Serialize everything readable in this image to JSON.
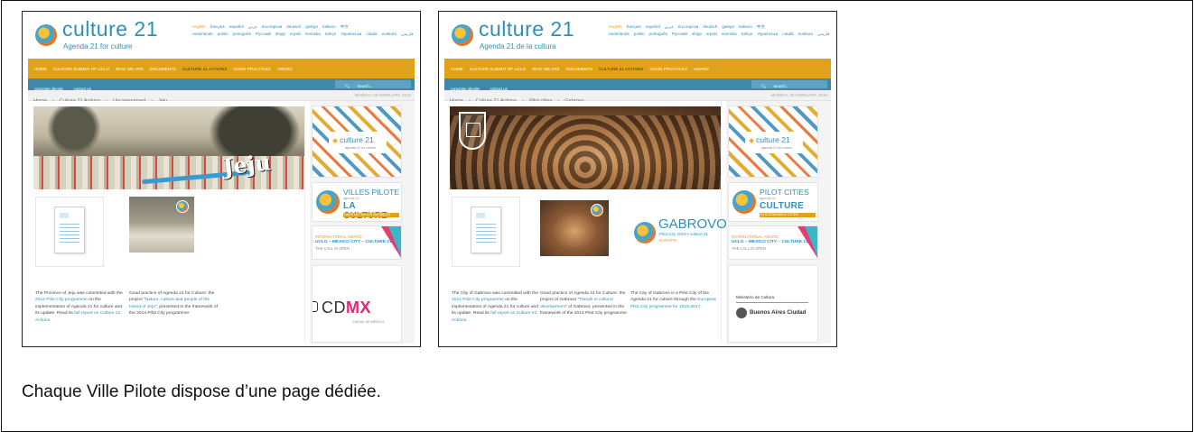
{
  "caption": "Chaque Ville Pilote dispose d’une page dédiée.",
  "languages": [
    {
      "label": "english",
      "active": true
    },
    {
      "label": "français",
      "active": false
    },
    {
      "label": "español",
      "active": false
    },
    {
      "label": "عربي",
      "active": false
    },
    {
      "label": "Български",
      "active": false
    },
    {
      "label": "deutsch",
      "active": false
    },
    {
      "label": "galego",
      "active": false
    },
    {
      "label": "italiano",
      "active": false
    },
    {
      "label": "中文",
      "active": false
    },
    {
      "label": "nederlands",
      "active": false
    },
    {
      "label": "polski",
      "active": false
    },
    {
      "label": "português",
      "active": false
    },
    {
      "label": "Русский",
      "active": false
    },
    {
      "label": "shqip",
      "active": false
    },
    {
      "label": "srpski",
      "active": false
    },
    {
      "label": "svenska",
      "active": false
    },
    {
      "label": "türkçe",
      "active": false
    },
    {
      "label": "Українська",
      "active": false
    },
    {
      "label": "català",
      "active": false
    },
    {
      "label": "euskara",
      "active": false
    },
    {
      "label": "فارسی",
      "active": false
    }
  ],
  "nav": [
    {
      "label": "HOME",
      "active": false
    },
    {
      "label": "CULTURE SUMMIT OF UCLG",
      "active": false
    },
    {
      "label": "WHO WE ARE",
      "active": false
    },
    {
      "label": "DOCUMENTS",
      "active": false
    },
    {
      "label": "CULTURE 21 ACTIONS",
      "active": true
    },
    {
      "label": "GOOD PRACTICES",
      "active": false
    },
    {
      "label": "AWARD",
      "active": false
    }
  ],
  "subnav": [
    "corporate identity",
    "contact us"
  ],
  "search_placeholder": "Search...",
  "date": "MONDAY, 08 FEBRUARY, 2016",
  "site": {
    "logo": "culture 21",
    "tagline_1": "Agenda 21 for culture",
    "tagline_2": "Agenda 21 de la cultura"
  },
  "jeju": {
    "crumbs": [
      "Home",
      "›",
      "Culture 21 Actions",
      "›",
      "Uncategorised",
      "›",
      "Jeju"
    ],
    "hero_word": "Jeju",
    "para1": {
      "pre": "The Province of Jeju was committed with the ",
      "link1": "2014 Pilot City programme",
      "mid": " on the implementation of Agenda 21 for culture and its update. Read its ",
      "link2": "full report on Culture 21: Actions",
      "post": "."
    },
    "para2": {
      "pre": "Good practice of Agenda 21 for Culture: the project \"",
      "link": "Nature, culture and people of the Island of Jeju",
      "post": "\", presented in the framework of the 2014 Pilot City programme."
    },
    "side": {
      "b1_logo": "culture 21",
      "b1_sub": "agenda 21 for culture",
      "b2_t1": "VILLES PILOTE",
      "b2_t2": "agenda 21",
      "b2_t3": "LA CULTURE",
      "b2_t4": "DANS LES VILLES DURABLES",
      "b3_l1": "INTERNATIONAL AWARD",
      "b3_l2": "UCLG – MEXICO CITY – CULTURE 21",
      "b3_l3": "THE CALL IS OPEN",
      "b4_brand": "CD",
      "b4_brand_hi": "MX",
      "b4_sub": "CIUDAD DE MÉXICO"
    }
  },
  "gabrovo": {
    "crumbs": [
      "Home",
      "›",
      "Culture 21 Actions",
      "›",
      "Pilot cities",
      "›",
      "Gabrovo"
    ],
    "badge_title": "GABROVO",
    "badge_line1": "Pilot City 2016 • culture 21",
    "badge_line2": "EUROPE",
    "para1": {
      "pre": "The City of Gabrovo was committed with the ",
      "link1": "2014 Pilot City programme",
      "mid": " on the implementation of Agenda 21 for culture and its update. Read its ",
      "link2": "full report on Culture 21: Actions",
      "post": "."
    },
    "para2": {
      "pre": "Good practice of Agenda 21 for Culture: the project of Gabrovo \"",
      "link": "Trends in cultural development",
      "post": "\" of Gabrovo, presented in the framework of the 2014 Pilot City programme."
    },
    "para3": {
      "pre": "The City of Gabrovo is a Pilot City of the Agenda 21 for culture through the ",
      "link": "European Pilot City programme for 2015-2017",
      "post": "."
    },
    "side": {
      "b1_logo": "culture 21",
      "b1_sub": "agenda 21 for culture",
      "b2_t1": "PILOT CITIES",
      "b2_t2": "agenda 21",
      "b2_t3": "CULTURE",
      "b2_t4": "IN SUSTAINABLE CITIES",
      "b3_l1": "INTERNATIONAL AWARD",
      "b3_l2": "UCLG – MEXICO CITY – CULTURE 21",
      "b3_l3": "THE CALL IS OPEN",
      "b4_ministry": "Ministerio de Cultura",
      "b4_name": "Buenos Aires Ciudad"
    }
  }
}
